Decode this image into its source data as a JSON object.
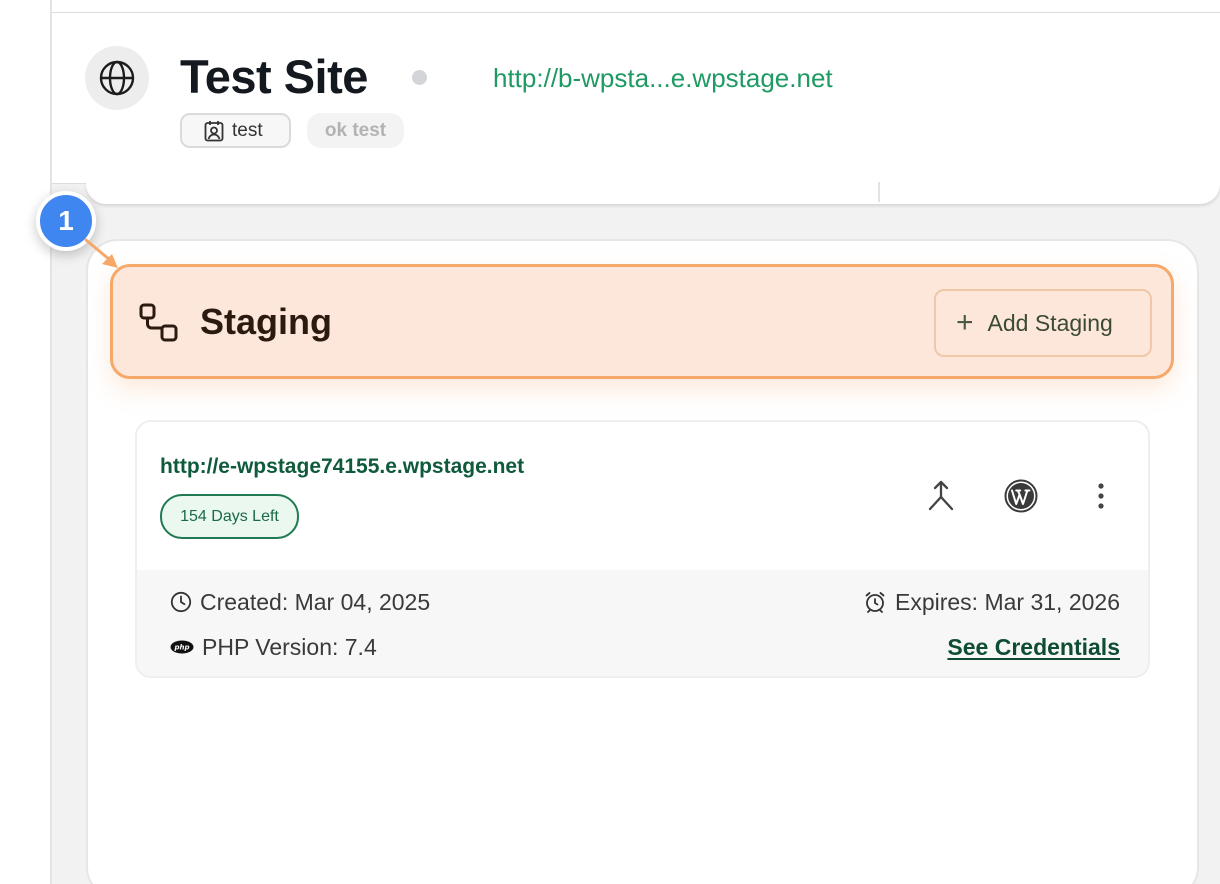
{
  "site": {
    "title": "Test Site",
    "url": "http://b-wpsta...e.wpstage.net",
    "status": "inactive",
    "tags": {
      "user": "test",
      "note": "ok test"
    }
  },
  "annotation": {
    "step": "1"
  },
  "staging": {
    "title": "Staging",
    "add_button_label": "Add Staging",
    "environments": [
      {
        "url": "http://e-wpstage74155.e.wpstage.net",
        "days_left": "154 Days Left",
        "created": "Created: Mar 04, 2025",
        "expires": "Expires: Mar 31, 2026",
        "php_version": "PHP Version: 7.4",
        "credentials_link": "See Credentials",
        "actions": [
          "merge-icon",
          "wordpress-icon",
          "more-vertical-icon"
        ]
      }
    ]
  },
  "colors": {
    "accent_green": "#1f9a63",
    "staging_highlight_bg": "#fde7da",
    "staging_highlight_border": "#f6a86a",
    "step_badge": "#3f86f0"
  }
}
